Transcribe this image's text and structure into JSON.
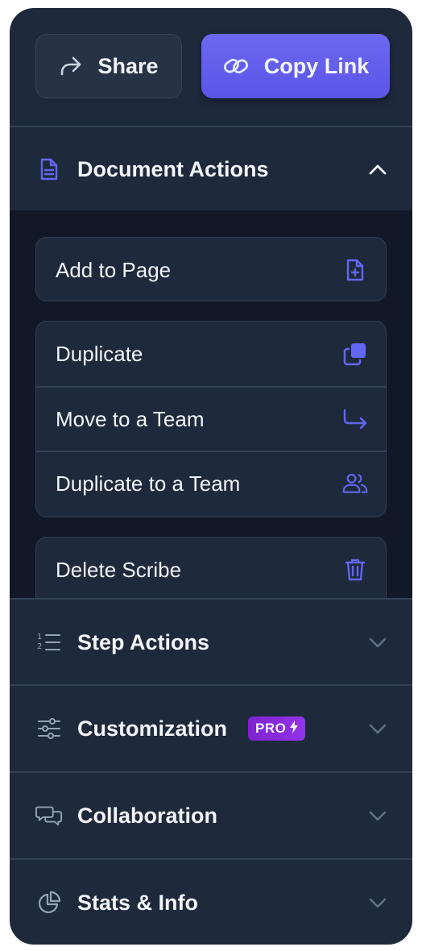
{
  "header": {
    "share_label": "Share",
    "copy_link_label": "Copy Link"
  },
  "sections": {
    "document_actions": {
      "label": "Document Actions",
      "expanded": true,
      "items": {
        "add_to_page": "Add to Page",
        "duplicate": "Duplicate",
        "move_to_team": "Move to a Team",
        "duplicate_to_team": "Duplicate to a Team",
        "delete_scribe": "Delete Scribe"
      }
    },
    "step_actions": {
      "label": "Step Actions",
      "expanded": false
    },
    "customization": {
      "label": "Customization",
      "badge": "PRO",
      "expanded": false
    },
    "collaboration": {
      "label": "Collaboration",
      "expanded": false
    },
    "stats_info": {
      "label": "Stats & Info",
      "expanded": false
    }
  },
  "colors": {
    "panel_bg": "#1e293b",
    "accent": "#6366f1",
    "pro_badge": "#9333ea"
  }
}
